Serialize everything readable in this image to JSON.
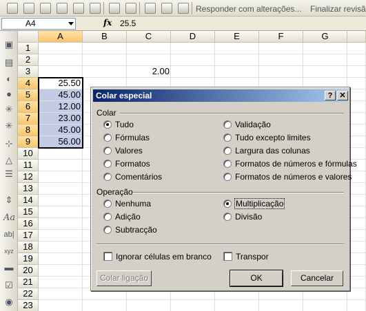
{
  "toolbar": {
    "respond_label": "Responder com alterações...",
    "finish_label": "Finalizar revisão..."
  },
  "formula_bar": {
    "name_box": "A4",
    "fx_label": "fx",
    "value": "25.5"
  },
  "sheet": {
    "columns": [
      "A",
      "B",
      "C",
      "D",
      "E",
      "F",
      "G"
    ],
    "rows": [
      "1",
      "2",
      "3",
      "4",
      "5",
      "6",
      "7",
      "8",
      "9",
      "10",
      "11",
      "12",
      "13",
      "14",
      "15",
      "16",
      "17",
      "18",
      "19",
      "20",
      "21",
      "22",
      "23"
    ],
    "c3": "2.00",
    "a_values": [
      "25.50",
      "45.00",
      "12.00",
      "23.00",
      "45.00",
      "56.00"
    ]
  },
  "dialog": {
    "title": "Colar especial",
    "help_btn": "?",
    "close_btn": "✕",
    "paste_group": "Colar",
    "paste_left": [
      "Tudo",
      "Fórmulas",
      "Valores",
      "Formatos",
      "Comentários"
    ],
    "paste_right": [
      "Validação",
      "Tudo excepto limites",
      "Largura das colunas",
      "Formatos de números e fórmulas",
      "Formatos de números e valores"
    ],
    "op_group": "Operação",
    "op_left": [
      "Nenhuma",
      "Adição",
      "Subtracção"
    ],
    "op_right": [
      "Multiplicação",
      "Divisão"
    ],
    "skip_blanks": "Ignorar células em branco",
    "transpose": "Transpor",
    "paste_link": "Colar ligação",
    "ok": "OK",
    "cancel": "Cancelar"
  }
}
